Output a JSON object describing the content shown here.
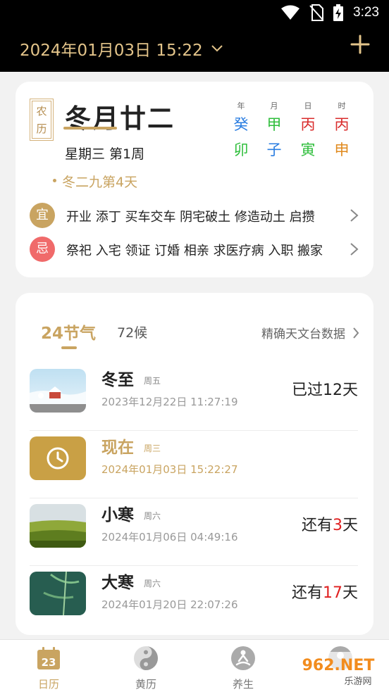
{
  "status_bar": {
    "time": "3:23"
  },
  "header": {
    "date_time": "2024年01月03日 15:22"
  },
  "lunar_card": {
    "badge": "农历",
    "lunar_date": "冬月廿二",
    "week_info": "星期三 第1周",
    "jiu_info": "冬二九第4天",
    "ganzhi": [
      {
        "label": "年",
        "stem": "癸",
        "branch": "卯",
        "stem_color": "#2a7de1",
        "branch_color": "#2fbe3c"
      },
      {
        "label": "月",
        "stem": "甲",
        "branch": "子",
        "stem_color": "#2fbe3c",
        "branch_color": "#2a7de1"
      },
      {
        "label": "日",
        "stem": "丙",
        "branch": "寅",
        "stem_color": "#d92b2b",
        "branch_color": "#2fbe3c"
      },
      {
        "label": "时",
        "stem": "丙",
        "branch": "申",
        "stem_color": "#d92b2b",
        "branch_color": "#e08a1e"
      }
    ],
    "yi": {
      "label": "宜",
      "text": "开业 添丁 买车交车 阴宅破土 修造动土 启攒"
    },
    "ji": {
      "label": "忌",
      "text": "祭祀 入宅 领证 订婚 相亲 求医疗病 入职 搬家"
    }
  },
  "terms_card": {
    "tab_active": "24节气",
    "tab_inactive": "72候",
    "link": "精确天文台数据",
    "rows": [
      {
        "name": "冬至",
        "weekday": "周五",
        "datetime": "2023年12月22日 11:27:19",
        "status_prefix": "已过",
        "status_num": "12",
        "status_suffix": "天"
      },
      {
        "name": "现在",
        "weekday": "周三",
        "datetime": "2024年01月03日 15:22:27"
      },
      {
        "name": "小寒",
        "weekday": "周六",
        "datetime": "2024年01月06日 04:49:16",
        "status_prefix": "还有",
        "status_num": "3",
        "status_suffix": "天"
      },
      {
        "name": "大寒",
        "weekday": "周六",
        "datetime": "2024年01月20日 22:07:26",
        "status_prefix": "还有",
        "status_num": "17",
        "status_suffix": "天"
      }
    ]
  },
  "bottom_nav": {
    "items": [
      {
        "label": "日历",
        "icon": "calendar-icon",
        "icon_text": "23"
      },
      {
        "label": "黄历",
        "icon": "yin-yang-icon"
      },
      {
        "label": "养生",
        "icon": "meditation-icon"
      },
      {
        "label": "",
        "icon": "person-icon"
      }
    ]
  },
  "watermark": {
    "logo": "962.NET",
    "text": "乐游网"
  },
  "colors": {
    "accent": "#c9a461",
    "yi": "#c9a461",
    "ji": "#f06a6a",
    "count": "#e02020"
  }
}
